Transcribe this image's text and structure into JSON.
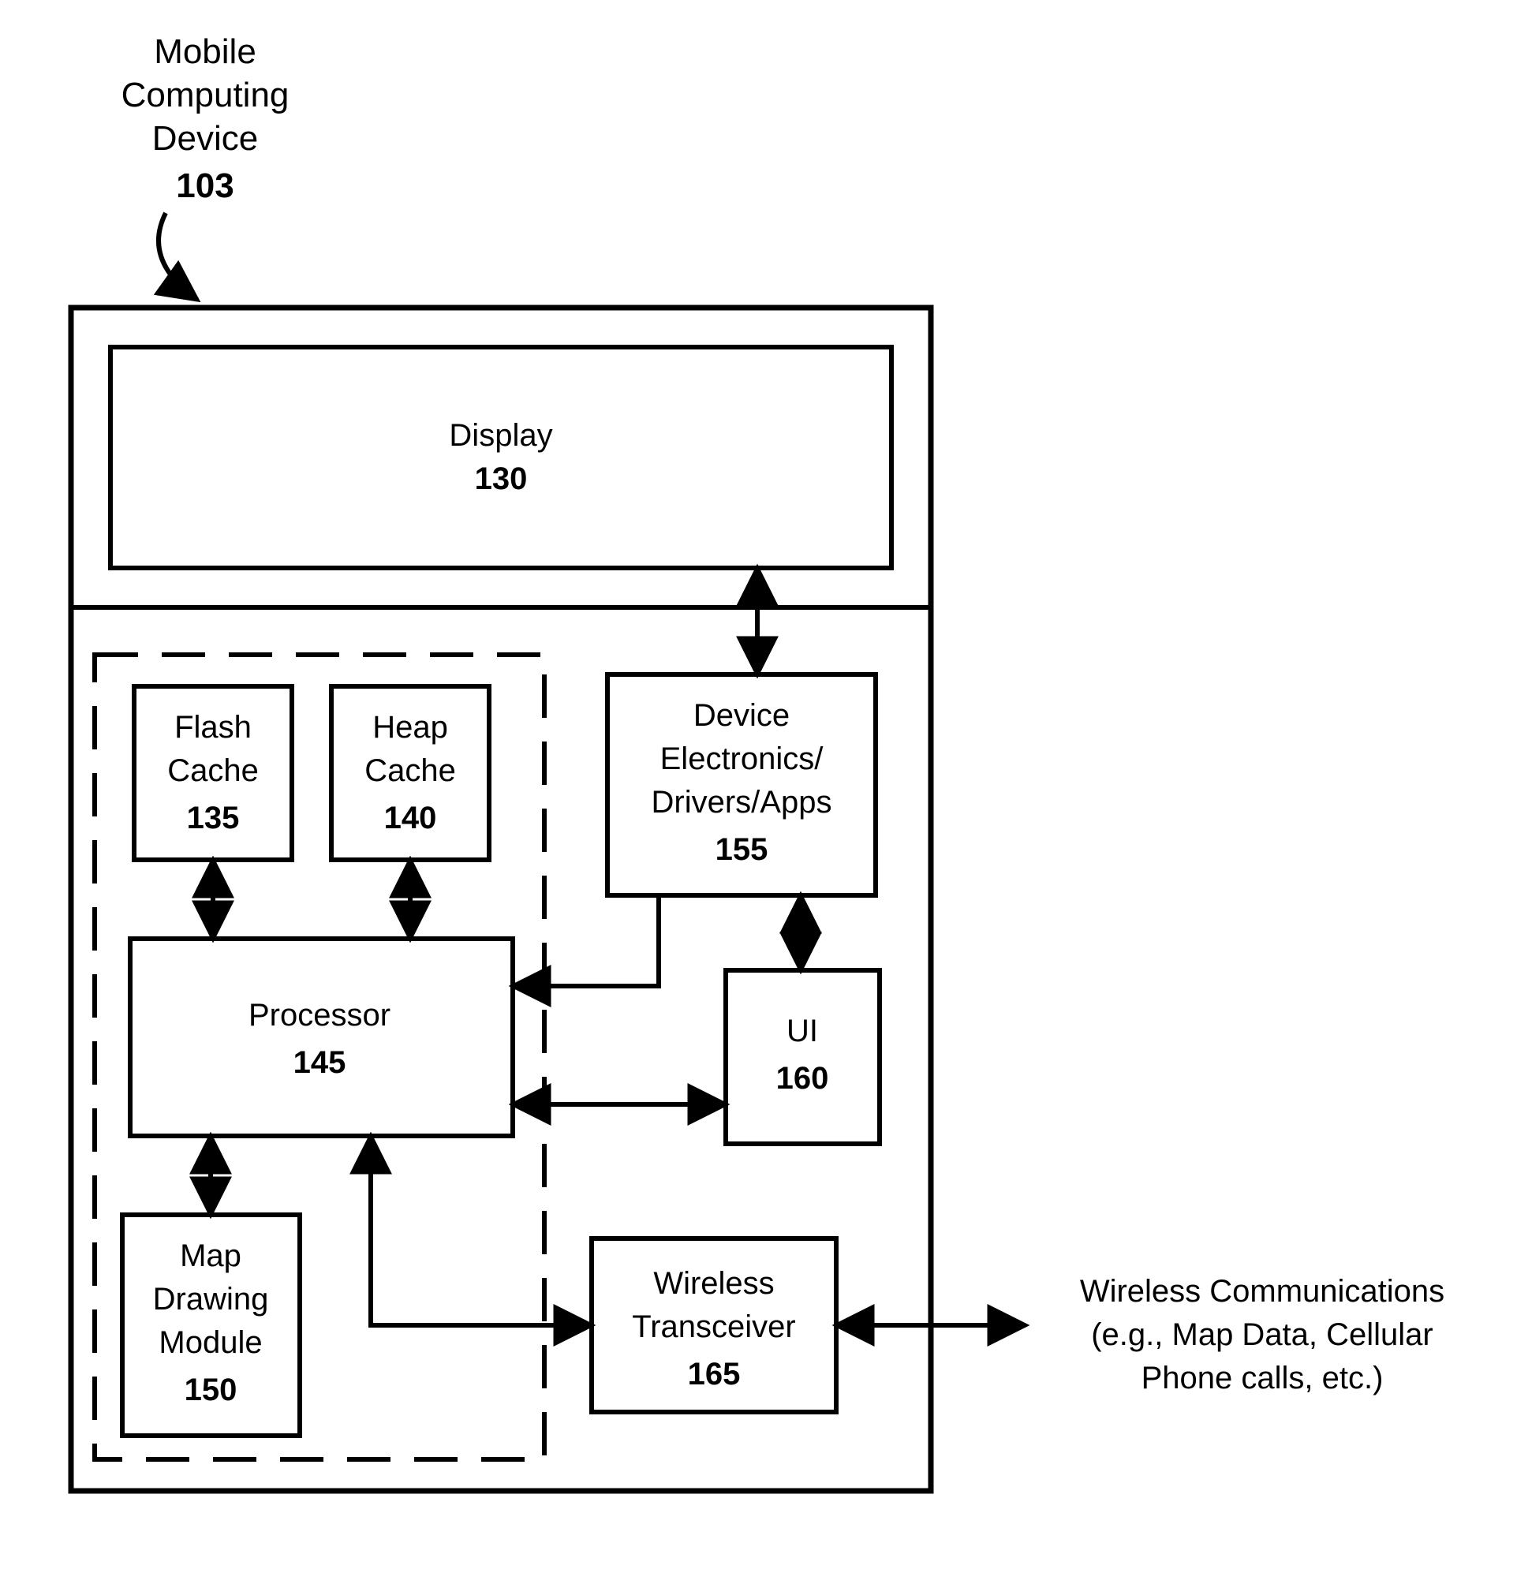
{
  "header": {
    "line1": "Mobile",
    "line2": "Computing",
    "line3": "Device",
    "ref": "103"
  },
  "blocks": {
    "display": {
      "label": "Display",
      "ref": "130"
    },
    "flash": {
      "line1": "Flash",
      "line2": "Cache",
      "ref": "135"
    },
    "heap": {
      "line1": "Heap",
      "line2": "Cache",
      "ref": "140"
    },
    "processor": {
      "label": "Processor",
      "ref": "145"
    },
    "map": {
      "line1": "Map",
      "line2": "Drawing",
      "line3": "Module",
      "ref": "150"
    },
    "device": {
      "line1": "Device",
      "line2": "Electronics/",
      "line3": "Drivers/Apps",
      "ref": "155"
    },
    "ui": {
      "label": "UI",
      "ref": "160"
    },
    "wireless": {
      "line1": "Wireless",
      "line2": "Transceiver",
      "ref": "165"
    }
  },
  "ext": {
    "line1": "Wireless Communications",
    "line2": "(e.g., Map Data, Cellular",
    "line3": "Phone calls, etc.)"
  }
}
